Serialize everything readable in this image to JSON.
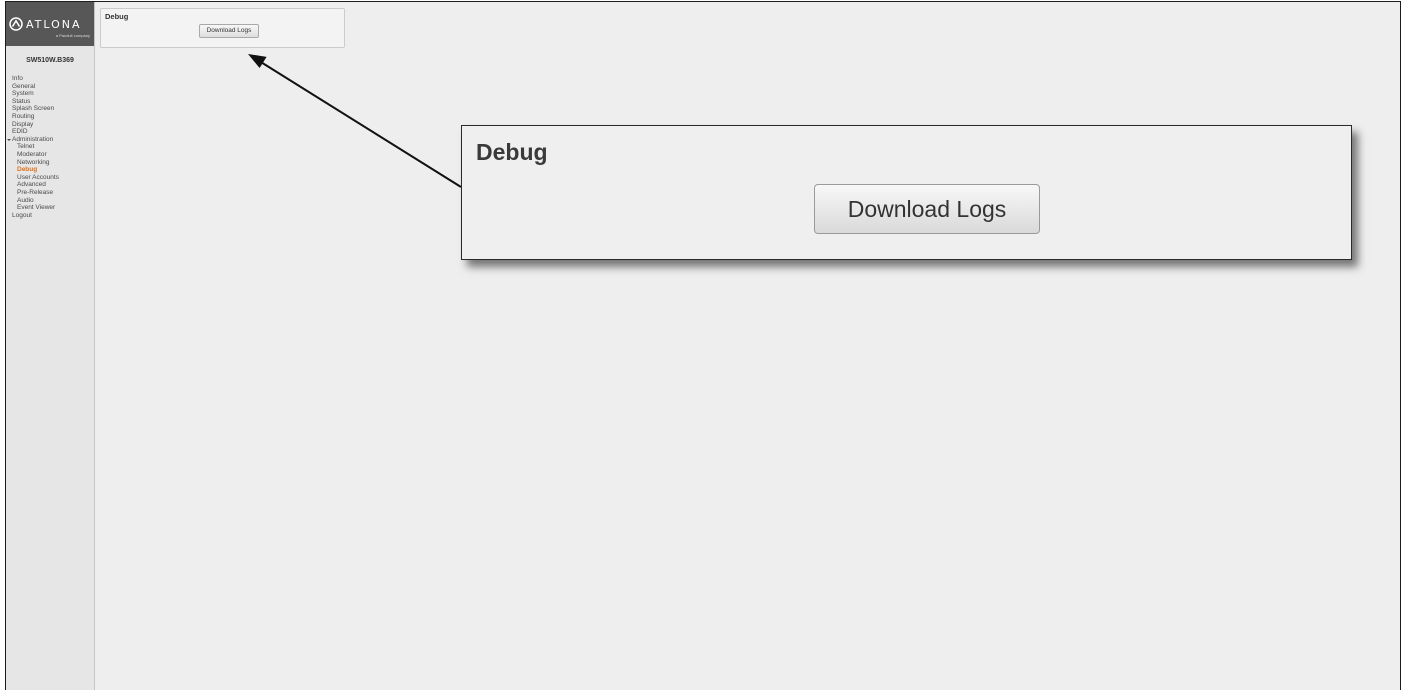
{
  "brand": {
    "name": "ATLONA",
    "tagline": "a Panduit company",
    "logo_icon": "atlona-logo-icon"
  },
  "device": {
    "name": "SW510W.B369"
  },
  "nav": {
    "items": [
      {
        "label": "Info"
      },
      {
        "label": "General"
      },
      {
        "label": "System"
      },
      {
        "label": "Status"
      },
      {
        "label": "Splash Screen"
      },
      {
        "label": "Routing"
      },
      {
        "label": "Display"
      },
      {
        "label": "EDID"
      },
      {
        "label": "Administration",
        "expanded": true
      },
      {
        "label": "Telnet"
      },
      {
        "label": "Moderator"
      },
      {
        "label": "Networking"
      },
      {
        "label": "Debug",
        "active": true
      },
      {
        "label": "User Accounts"
      },
      {
        "label": "Advanced"
      },
      {
        "label": "Pre-Release"
      },
      {
        "label": "Audio"
      },
      {
        "label": "Event Viewer"
      },
      {
        "label": "Logout"
      }
    ]
  },
  "debug_panel": {
    "title": "Debug",
    "button_label": "Download Logs"
  },
  "callout": {
    "title": "Debug",
    "button_label": "Download Logs"
  },
  "colors": {
    "active_nav": "#e0701a",
    "logo_background": "#575757",
    "page_background": "#eeeeee"
  }
}
